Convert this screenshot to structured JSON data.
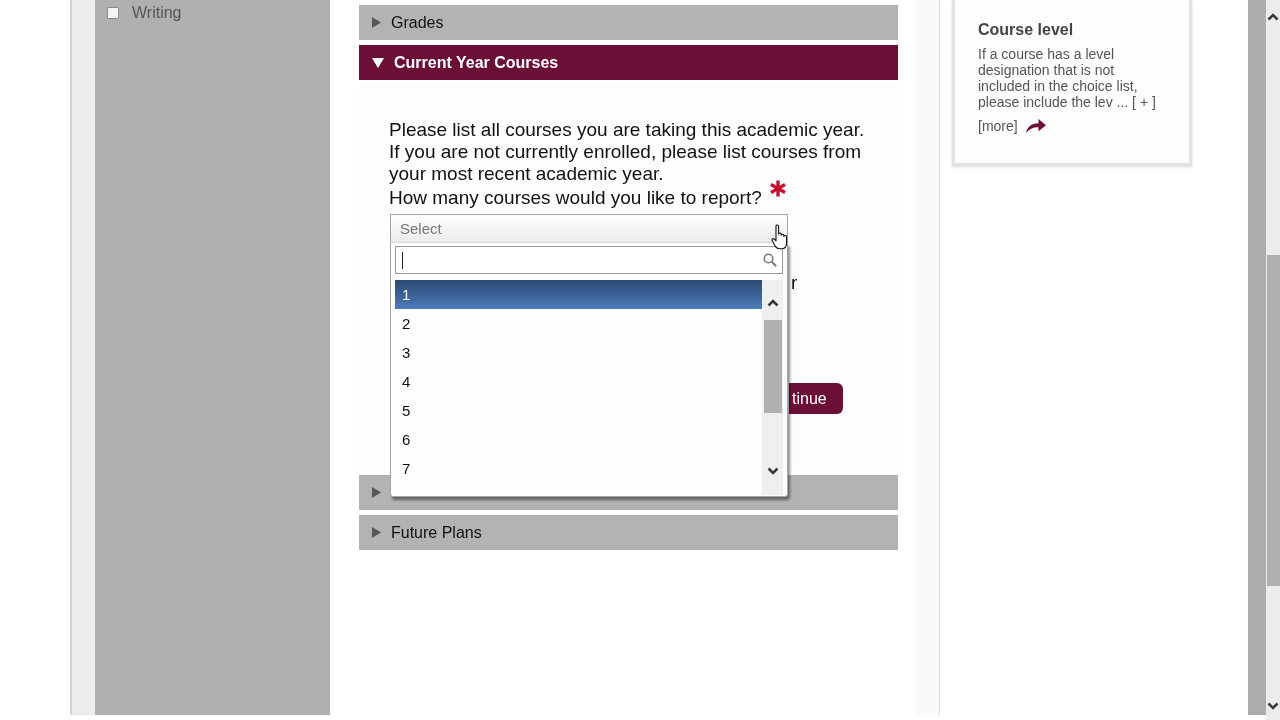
{
  "sidebar": {
    "items": [
      {
        "label": "Writing",
        "checked": false
      }
    ]
  },
  "sections": [
    {
      "title": "Grades",
      "expanded": false
    },
    {
      "title": "Current Year Courses",
      "expanded": true,
      "intro": "Please list all courses you are taking this academic year. If you are not currently enrolled, please list courses from your most recent academic year.",
      "question": "How many courses would you like to report?",
      "required": true,
      "select": {
        "placeholder": "Select",
        "open": true,
        "search": {
          "focused": true
        },
        "options": [
          {
            "label": "1",
            "selected": true
          },
          {
            "label": "2",
            "selected": false
          },
          {
            "label": "3",
            "selected": false
          },
          {
            "label": "4",
            "selected": false
          },
          {
            "label": "5",
            "selected": false
          },
          {
            "label": "6",
            "selected": false
          },
          {
            "label": "7",
            "selected": false
          }
        ]
      },
      "text_fragment": "r",
      "button_label": "tinue"
    },
    {
      "expanded": false
    },
    {
      "title": "Future Plans",
      "expanded": false
    }
  ],
  "help_card": {
    "title": "Course level",
    "text": "If a course has a level designation that is not included in the choice list, please include the lev ...",
    "expand_link": "[ + ]",
    "more_link": "[more]"
  }
}
